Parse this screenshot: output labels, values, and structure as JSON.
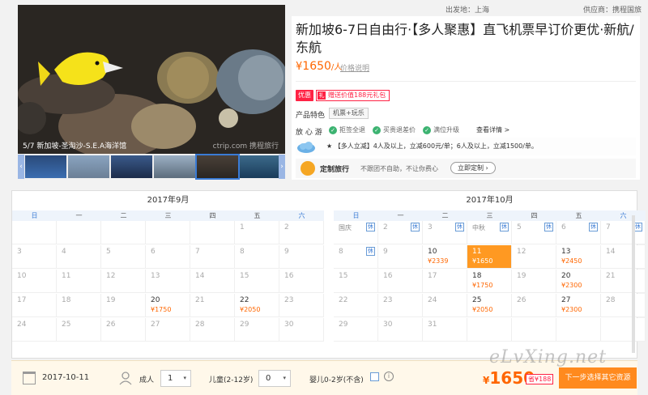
{
  "header": {
    "departure": "出发地：上海",
    "supplier": "供应商：携程国旅"
  },
  "gallery": {
    "caption": "5/7 新加坡-圣淘沙-S.E.A海洋馆",
    "watermark": "ctrip.com 携程旅行"
  },
  "product": {
    "title": "新加坡6-7日自由行·【多人聚惠】直飞机票早订价更优·新航/东航",
    "price_symbol": "¥",
    "price": "1650",
    "price_unit": "/人",
    "price_link": "价格说明",
    "promo_tag": "优惠",
    "gift": "赠送价值188元礼包",
    "gift_icon_char": "礼",
    "feature_label": "产品特色",
    "feature_chip": "机票+玩乐",
    "worry_label": "放 心 游",
    "worry_items": [
      "拒签全退",
      "买贵退差价",
      "满位升级"
    ],
    "detail_link": "查看详情 >",
    "promo_text": "★ 【多人立减】4人及以上，立减600元/单；6人及以上，立减1500/单。",
    "custom_title": "定制旅行",
    "custom_desc": "不跟团不自助，不让你费心",
    "custom_button": "立即定制 ›"
  },
  "calendar": {
    "weekdays": [
      "日",
      "一",
      "二",
      "三",
      "四",
      "五",
      "六"
    ],
    "rest_label": "休",
    "months": [
      {
        "title": "2017年9月",
        "first_weekday": 5,
        "days": 30,
        "prices": {
          "20": "¥1750",
          "22": "¥2050"
        },
        "holidays": {},
        "rest_days": []
      },
      {
        "title": "2017年10月",
        "first_weekday": 0,
        "days": 31,
        "prices": {
          "10": "¥2339",
          "11": "¥1650",
          "13": "¥2450",
          "18": "¥1750",
          "20": "¥2300",
          "25": "¥2050",
          "27": "¥2300"
        },
        "holidays": {
          "1": "国庆",
          "4": "中秋"
        },
        "rest_days": [
          1,
          2,
          3,
          4,
          5,
          6,
          7,
          8
        ],
        "selected": 11
      }
    ]
  },
  "booking": {
    "date": "2017-10-11",
    "adult_label": "成人",
    "adult_count": "1",
    "child_label": "儿童(2-12岁)",
    "child_count": "0",
    "infant_label": "婴儿0-2岁(不含)",
    "info_icon_char": "i",
    "caret_char": "▾",
    "total_symbol": "¥",
    "total": "1650",
    "save_label": "省¥188",
    "submit_label": "下一步选择其它资源",
    "watermark": "eLvXing.net"
  },
  "colors": {
    "accent": "#ff6600",
    "selected": "#ff9922",
    "weekday_blue": "#3a7bd5"
  }
}
